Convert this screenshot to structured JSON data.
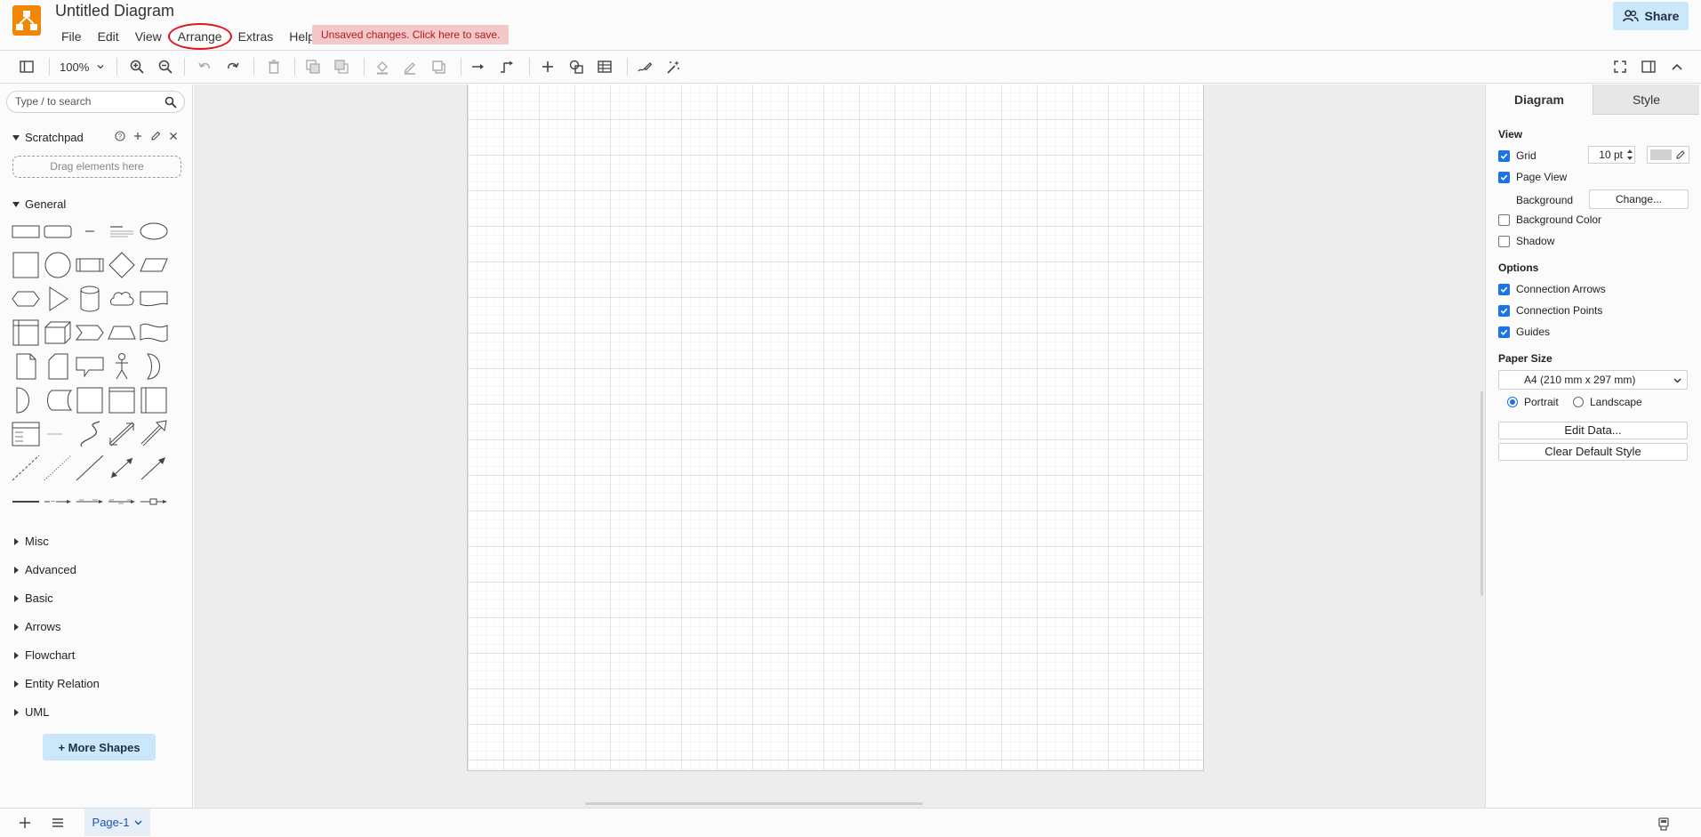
{
  "app": {
    "title": "Untitled Diagram",
    "logo_icon": "drawio-logo-icon",
    "menu": [
      "File",
      "Edit",
      "View",
      "Arrange",
      "Extras",
      "Help"
    ],
    "unsaved_notice": "Unsaved changes. Click here to save.",
    "share_label": "Share",
    "brand_color": "#f08705",
    "highlight_color": "#e0131f"
  },
  "toolbar": {
    "zoom": "100%",
    "icons": [
      "sidebar-toggle-icon",
      "zoom-in-icon",
      "zoom-out-icon",
      "undo-icon",
      "redo-icon",
      "delete-icon",
      "to-front-icon",
      "to-back-icon",
      "fill-color-icon",
      "line-color-icon",
      "shadow-icon",
      "connection-icon",
      "waypoint-icon",
      "insert-icon",
      "shape-icon",
      "table-icon",
      "freehand-icon",
      "magic-wand-icon",
      "fullscreen-icon",
      "format-panel-icon",
      "collapse-icon"
    ]
  },
  "left": {
    "search_placeholder": "Type / to search",
    "scratchpad_title": "Scratchpad",
    "scratchpad_drop": "Drag elements here",
    "general_title": "General",
    "sections": [
      "Misc",
      "Advanced",
      "Basic",
      "Arrows",
      "Flowchart",
      "Entity Relation",
      "UML"
    ],
    "more_shapes": "+ More Shapes"
  },
  "right": {
    "tabs": [
      "Diagram",
      "Style"
    ],
    "view_header": "View",
    "grid_label": "Grid",
    "grid_checked": true,
    "grid_size": "10 pt",
    "page_view_label": "Page View",
    "page_view_checked": true,
    "background_label": "Background",
    "background_button": "Change...",
    "bg_color_label": "Background Color",
    "bg_color_checked": false,
    "shadow_label": "Shadow",
    "shadow_checked": false,
    "options_header": "Options",
    "conn_arrows_label": "Connection Arrows",
    "conn_points_label": "Connection Points",
    "guides_label": "Guides",
    "paper_size_header": "Paper Size",
    "paper_size_value": "A4 (210 mm x 297 mm)",
    "portrait_label": "Portrait",
    "landscape_label": "Landscape",
    "orientation": "Portrait",
    "edit_data_button": "Edit Data...",
    "clear_style_button": "Clear Default Style"
  },
  "footer": {
    "page_tab": "Page-1"
  }
}
